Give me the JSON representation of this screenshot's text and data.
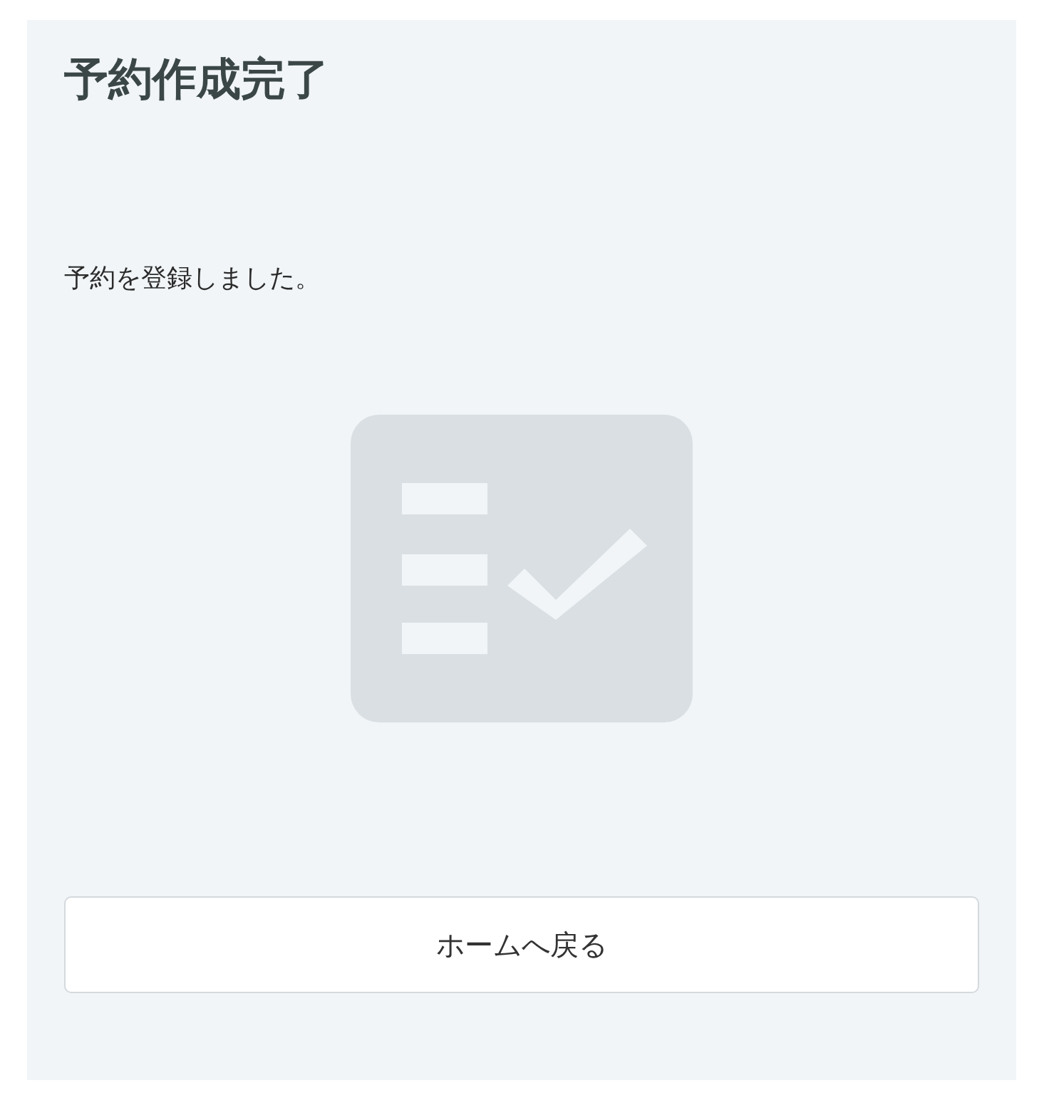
{
  "title": "予約作成完了",
  "message": "予約を登録しました。",
  "buttons": [
    {
      "label": "ホームへ戻る"
    }
  ]
}
